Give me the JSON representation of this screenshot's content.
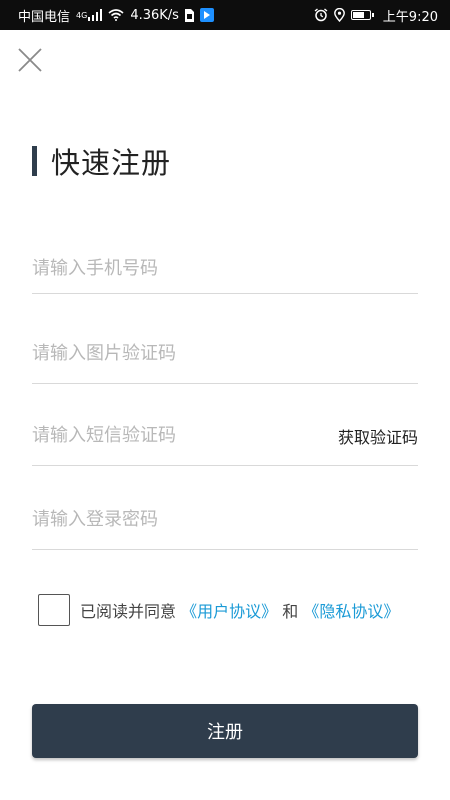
{
  "status_bar": {
    "carrier": "中国电信",
    "network": "4G",
    "speed": "4.36K/s",
    "time": "上午9:20",
    "battery_level": 0.6
  },
  "colors": {
    "primary": "#2f3d4c",
    "link": "#1a9ad6",
    "placeholder": "#b8b8b8",
    "divider": "#d9d9d9"
  },
  "page": {
    "title": "快速注册"
  },
  "form": {
    "phone_placeholder": "请输入手机号码",
    "captcha_placeholder": "请输入图片验证码",
    "sms_placeholder": "请输入短信验证码",
    "get_code_label": "获取验证码",
    "password_placeholder": "请输入登录密码"
  },
  "agreement": {
    "checked": false,
    "prefix": "已阅读并同意",
    "user_agreement": "《用户协议》",
    "conjunction": "和",
    "privacy_policy": "《隐私协议》"
  },
  "actions": {
    "register_label": "注册"
  }
}
